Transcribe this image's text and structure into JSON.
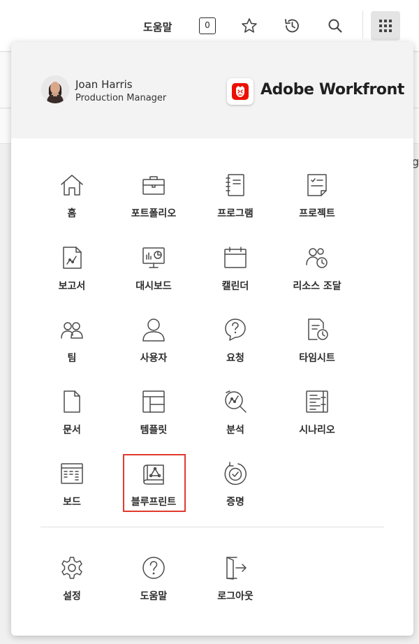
{
  "topbar": {
    "help_label": "도움말",
    "notifications_count": "0",
    "icons": [
      "star-icon",
      "history-icon",
      "search-icon",
      "apps-grid-icon"
    ]
  },
  "background": {
    "cut_text": "g"
  },
  "user": {
    "name": "Joan Harris",
    "role": "Production Manager"
  },
  "brand": {
    "name": "Adobe Workfront",
    "accent": "#eb1000"
  },
  "menu": {
    "items": [
      {
        "label": "홈",
        "icon": "home-icon"
      },
      {
        "label": "포트폴리오",
        "icon": "briefcase-icon"
      },
      {
        "label": "프로그램",
        "icon": "notebook-icon"
      },
      {
        "label": "프로젝트",
        "icon": "project-icon"
      },
      {
        "label": "보고서",
        "icon": "report-icon"
      },
      {
        "label": "대시보드",
        "icon": "dashboard-icon"
      },
      {
        "label": "캘린더",
        "icon": "calendar-icon"
      },
      {
        "label": "리소스 조달",
        "icon": "resourcing-icon"
      },
      {
        "label": "팀",
        "icon": "team-icon"
      },
      {
        "label": "사용자",
        "icon": "user-icon"
      },
      {
        "label": "요청",
        "icon": "request-icon"
      },
      {
        "label": "타임시트",
        "icon": "timesheet-icon"
      },
      {
        "label": "문서",
        "icon": "document-icon"
      },
      {
        "label": "템플릿",
        "icon": "template-icon"
      },
      {
        "label": "분석",
        "icon": "analytics-icon"
      },
      {
        "label": "시나리오",
        "icon": "scenario-icon"
      },
      {
        "label": "보드",
        "icon": "board-icon"
      },
      {
        "label": "블루프린트",
        "icon": "blueprint-icon",
        "highlighted": true
      },
      {
        "label": "증명",
        "icon": "proof-icon"
      }
    ],
    "footer": [
      {
        "label": "설정",
        "icon": "gear-icon"
      },
      {
        "label": "도움말",
        "icon": "help-icon"
      },
      {
        "label": "로그아웃",
        "icon": "logout-icon"
      }
    ]
  },
  "colors": {
    "highlight": "#e03a2f",
    "header_bg": "#f3f3f3"
  }
}
